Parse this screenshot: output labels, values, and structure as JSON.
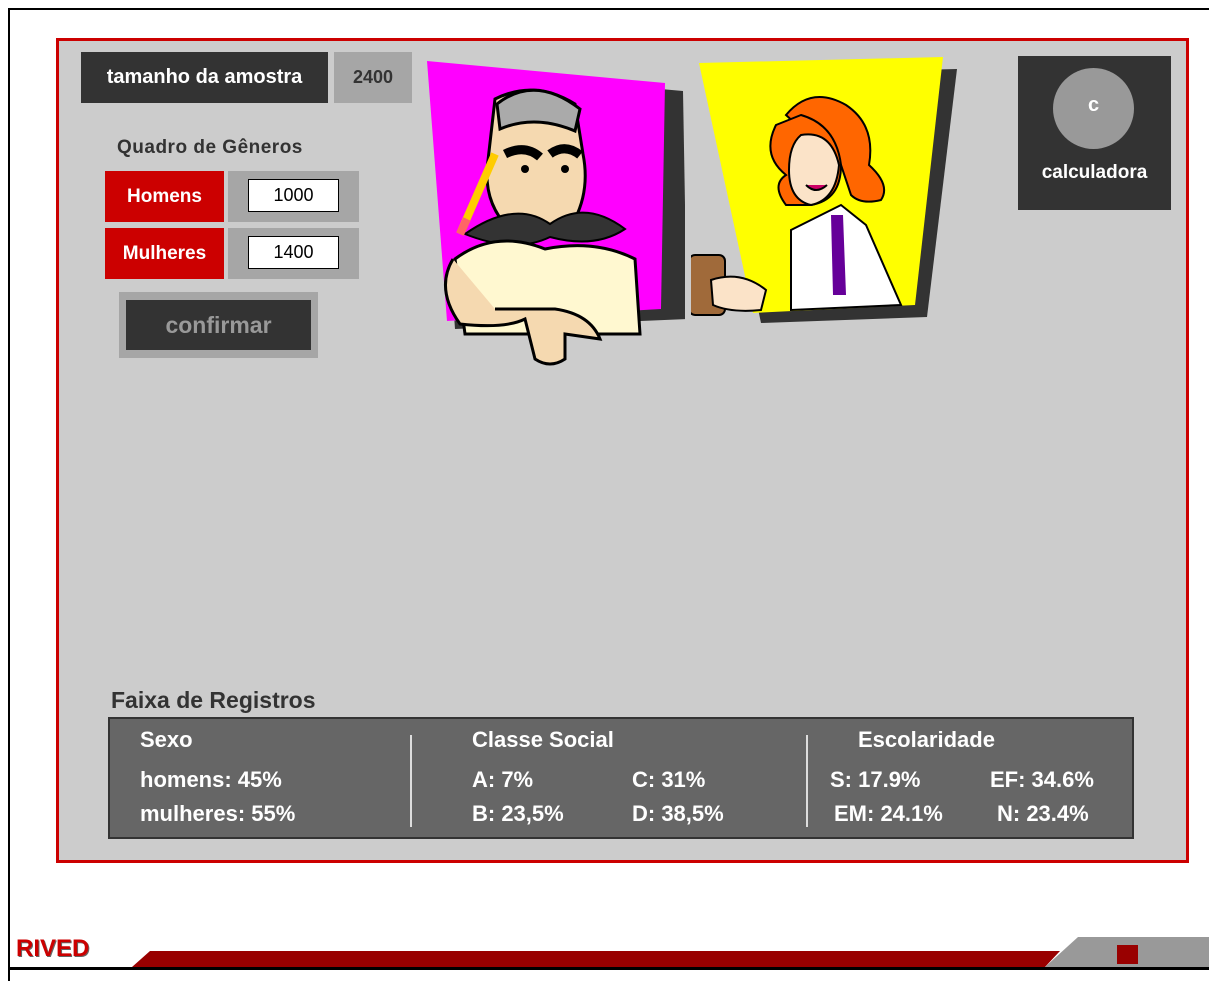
{
  "sample": {
    "label": "tamanho da amostra",
    "value": "2400"
  },
  "genders": {
    "title": "Quadro de  Gêneros",
    "men_label": "Homens",
    "men_value": "1000",
    "women_label": "Mulheres",
    "women_value": "1400"
  },
  "confirm_label": "confirmar",
  "calculator": {
    "key": "c",
    "label": "calculadora"
  },
  "characters": {
    "left": {
      "panel_color": "#ff00ff",
      "icon": "man-pencil-illustration"
    },
    "right": {
      "panel_color": "#ffff00",
      "icon": "woman-scientist-illustration"
    }
  },
  "registros": {
    "title": "Faixa de Registros",
    "sexo": {
      "head": "Sexo",
      "line1": "homens: 45%",
      "line2": "mulheres: 55%"
    },
    "classe": {
      "head": "Classe Social",
      "a": "A: 7%",
      "b": "B: 23,5%",
      "c": "C: 31%",
      "d": "D: 38,5%"
    },
    "escolaridade": {
      "head": "Escolaridade",
      "s": "S: 17.9%",
      "em": "EM: 24.1%",
      "ef": "EF: 34.6%",
      "n": "N: 23.4%"
    }
  },
  "footer": {
    "logo": "RIVED"
  },
  "colors": {
    "accent": "#cc0000",
    "stage": "#cccccc",
    "dark": "#333333"
  }
}
